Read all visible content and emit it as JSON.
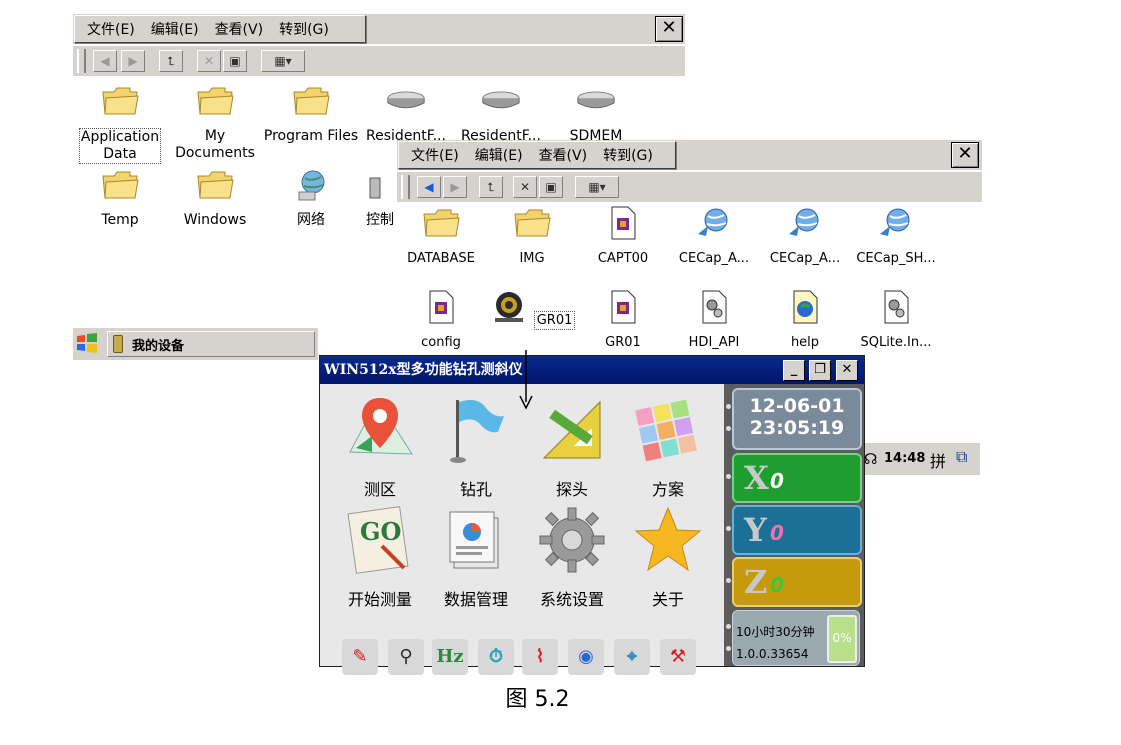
{
  "back_window": {
    "menu": [
      "文件(E)",
      "编辑(E)",
      "查看(V)",
      "转到(G)"
    ],
    "close": "✕",
    "icons": [
      {
        "label": "Application Data",
        "label1": "Application",
        "label2": "Data",
        "type": "folder"
      },
      {
        "label": "My Documents",
        "label1": "My",
        "label2": "Documents",
        "type": "folder"
      },
      {
        "label": "Program Files",
        "label1": "Program Files",
        "label2": "",
        "type": "folder"
      },
      {
        "label": "ResidentF...",
        "label1": "ResidentF...",
        "label2": "",
        "type": "drive"
      },
      {
        "label": "ResidentF...",
        "label1": "ResidentF...",
        "label2": "",
        "type": "drive"
      },
      {
        "label": "SDMEM",
        "label1": "SDMEM",
        "label2": "",
        "type": "drive"
      },
      {
        "label": "Temp",
        "label1": "Temp",
        "label2": "",
        "type": "folder"
      },
      {
        "label": "Windows",
        "label1": "Windows",
        "label2": "",
        "type": "folder"
      },
      {
        "label": "网络",
        "label1": "网络",
        "label2": "",
        "type": "network"
      },
      {
        "label": "控制",
        "label1": "控制",
        "label2": "",
        "type": "partial"
      }
    ]
  },
  "taskbar": {
    "item": "我的设备",
    "time": "14:48",
    "ime": "拼"
  },
  "front_window": {
    "menu": [
      "文件(E)",
      "编辑(E)",
      "查看(V)",
      "转到(G)"
    ],
    "close": "✕",
    "icons": [
      {
        "label": "DATABASE",
        "type": "folder"
      },
      {
        "label": "IMG",
        "type": "folder"
      },
      {
        "label": "CAPT00",
        "type": "file"
      },
      {
        "label": "CECap_A...",
        "type": "globe"
      },
      {
        "label": "CECap_A...",
        "type": "globe"
      },
      {
        "label": "CECap_SH...",
        "type": "globe"
      },
      {
        "label": "config",
        "type": "file"
      },
      {
        "label": "GR01",
        "type": "gr"
      },
      {
        "label": "GR01",
        "type": "file"
      },
      {
        "label": "HDI_API",
        "type": "gear-file"
      },
      {
        "label": "help",
        "type": "help"
      },
      {
        "label": "SQLite.In...",
        "type": "gear-file"
      }
    ]
  },
  "app": {
    "title": "WIN512x型多功能钻孔测斜仪",
    "datetime": {
      "date": "12-06-01",
      "time": "23:05:19"
    },
    "tiles": [
      "测区",
      "钻孔",
      "探头",
      "方案",
      "开始测量",
      "数据管理",
      "系统设置",
      "关于"
    ],
    "axes": [
      {
        "axis": "X",
        "value": "0",
        "color": "#1e9e2f"
      },
      {
        "axis": "Y",
        "value": "0",
        "color": "#1c6f96"
      },
      {
        "axis": "Z",
        "value": "0",
        "color": "#c69a0d"
      }
    ],
    "status": {
      "duration": "10小时30分钟",
      "version": "1.0.0.33654",
      "battery": "0%"
    },
    "bottom_icons": [
      "pen-icon",
      "connect-icon",
      "Hz",
      "timer-icon",
      "antenna-icon",
      "globe-icon",
      "map-pin-icon",
      "tool-icon"
    ]
  },
  "caption": "图 5.2",
  "colors": {
    "title_bar": "#0a2a8c",
    "side_bg": "#5c5c5c"
  }
}
